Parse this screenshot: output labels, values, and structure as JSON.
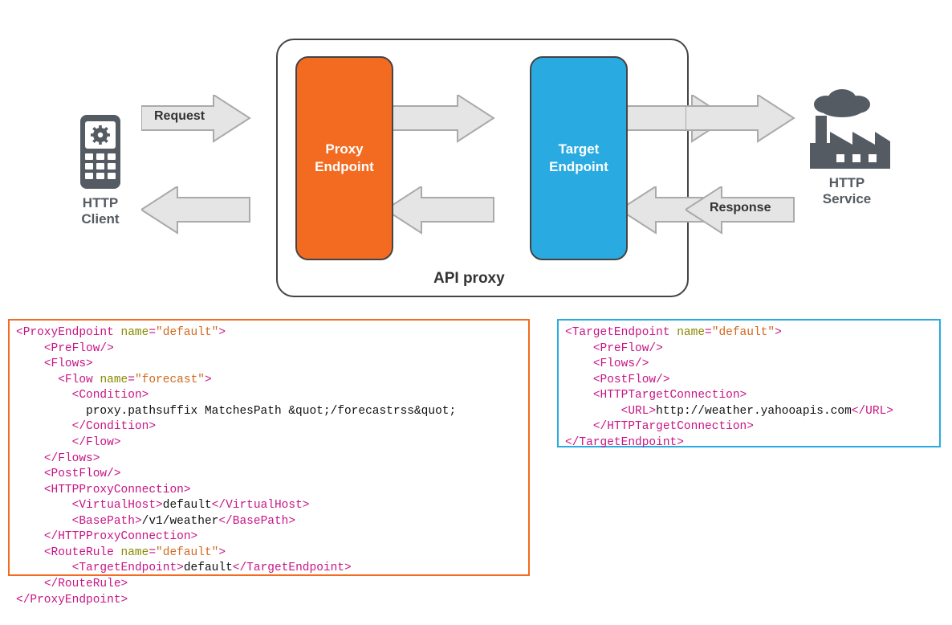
{
  "diagram": {
    "client_label": "HTTP\nClient",
    "service_label": "HTTP\nService",
    "request_label": "Request",
    "response_label": "Response",
    "api_proxy_label": "API proxy",
    "proxy_endpoint_label": "Proxy\nEndpoint",
    "target_endpoint_label": "Target\nEndpoint"
  },
  "colors": {
    "orange": "#f26b21",
    "blue": "#29abe2",
    "icon_gray": "#555b62",
    "arrow_fill": "#e5e5e5",
    "arrow_stroke": "#aaaaaa"
  },
  "proxy_endpoint_xml": {
    "root_name": "ProxyEndpoint",
    "root_attr_name": "name",
    "root_attr_value": "default",
    "flow_name": "forecast",
    "condition_text": "proxy.pathsuffix MatchesPath &quot;/forecastrss&quot;",
    "virtual_host": "default",
    "base_path": "/v1/weather",
    "route_rule_name": "default",
    "route_rule_target": "default"
  },
  "target_endpoint_xml": {
    "root_name": "TargetEndpoint",
    "root_attr_name": "name",
    "root_attr_value": "default",
    "url": "http://weather.yahooapis.com"
  }
}
